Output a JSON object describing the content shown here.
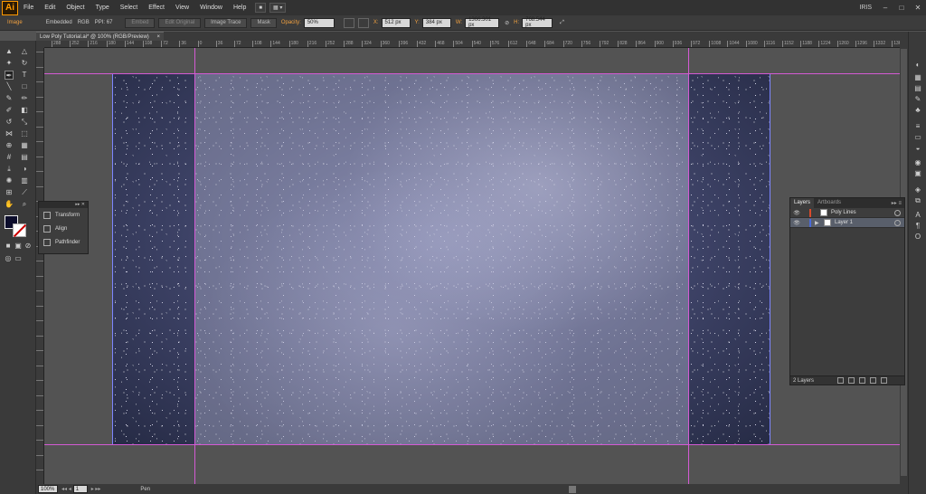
{
  "app": {
    "logo": "Ai",
    "workspace": "IRIS"
  },
  "menu": [
    "File",
    "Edit",
    "Object",
    "Type",
    "Select",
    "Effect",
    "View",
    "Window",
    "Help"
  ],
  "window_controls": [
    "–",
    "□",
    "✕"
  ],
  "control_bar": {
    "object_type": "Image",
    "embedded": "Embedded",
    "color_mode": "RGB",
    "ppi": "PPI: 67",
    "embed_btn": "Embed",
    "edit_original_btn": "Edit Original",
    "image_trace_btn": "Image Trace",
    "mask_btn": "Mask",
    "opacity_label": "Opacity:",
    "opacity_value": "50%",
    "x_label": "X:",
    "x_value": "512 px",
    "y_label": "Y:",
    "y_value": "384 px",
    "w_label": "W:",
    "w_value": "1366.301 px",
    "h_label": "H:",
    "h_value": "768.544 px"
  },
  "document": {
    "tab_title": "Low Poly Tutorial.ai* @ 100% (RGB/Preview)",
    "close": "×"
  },
  "ruler": {
    "h_labels": [
      "288",
      "252",
      "216",
      "180",
      "144",
      "108",
      "72",
      "36",
      "0",
      "36",
      "72",
      "108",
      "144",
      "180",
      "216",
      "252",
      "288",
      "324",
      "360",
      "396",
      "432",
      "468",
      "504",
      "540",
      "576",
      "612",
      "648",
      "684",
      "720",
      "756",
      "792",
      "828",
      "864",
      "900",
      "936",
      "972",
      "1008",
      "1044",
      "1080",
      "1116",
      "1152",
      "1188",
      "1224",
      "1260",
      "1296",
      "1332",
      "1368"
    ]
  },
  "panels": {
    "transform": "Transform",
    "align": "Align",
    "pathfinder": "Pathfinder",
    "panel_head": "▸▸ ✕"
  },
  "layers": {
    "tab_layers": "Layers",
    "tab_artboards": "Artboards",
    "rows": [
      {
        "name": "Poly Lines",
        "color": "#d94b2b"
      },
      {
        "name": "Layer 1",
        "color": "#4b6bd9"
      }
    ],
    "footer_count": "2 Layers"
  },
  "status": {
    "zoom": "100%",
    "artboard": "1",
    "tool": "Pen"
  },
  "colors": {
    "fill": "#0c0d2b",
    "guide": "#d45ad4",
    "bounds": "#7d86ff"
  }
}
